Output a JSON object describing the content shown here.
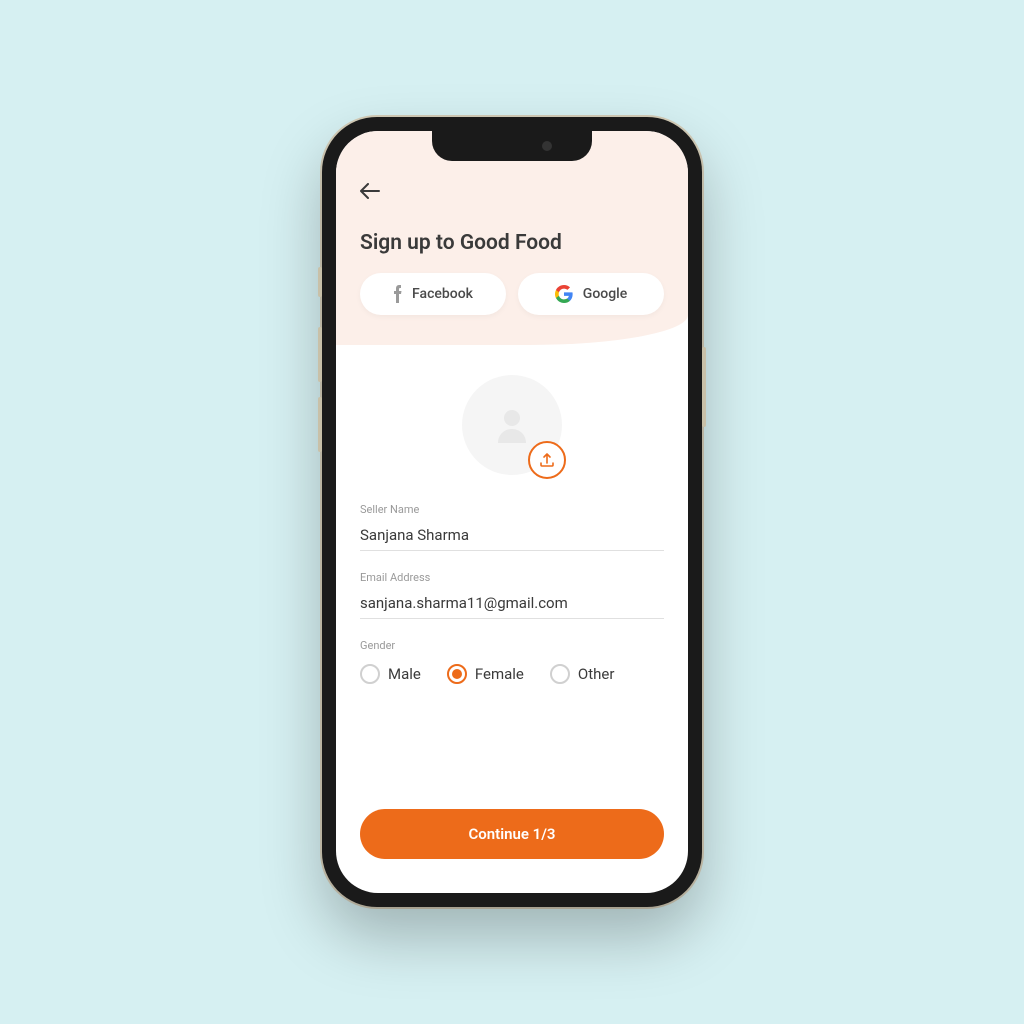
{
  "page": {
    "title": "Sign up to Good Food"
  },
  "social": {
    "facebook": "Facebook",
    "google": "Google"
  },
  "fields": {
    "name_label": "Seller Name",
    "name_value": "Sanjana Sharma",
    "email_label": "Email Address",
    "email_value": "sanjana.sharma11@gmail.com",
    "gender_label": "Gender"
  },
  "gender_options": {
    "male": "Male",
    "female": "Female",
    "other": "Other",
    "selected": "female"
  },
  "cta": {
    "continue": "Continue 1/3"
  },
  "colors": {
    "accent": "#ed6b1a",
    "header_bg": "#fcefe9"
  }
}
